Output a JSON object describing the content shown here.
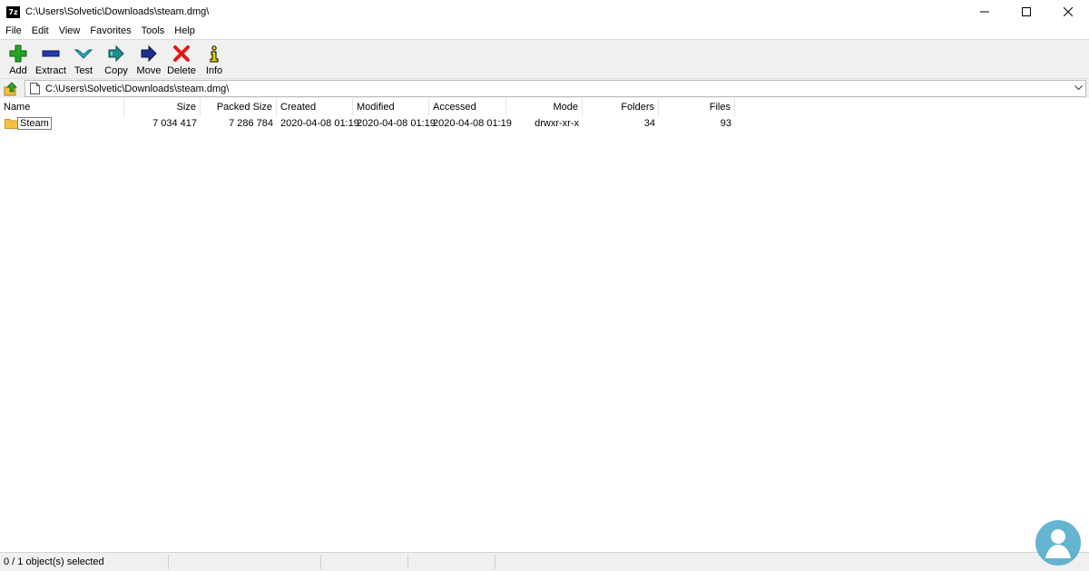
{
  "window": {
    "app_icon_text": "7z",
    "title": "C:\\Users\\Solvetic\\Downloads\\steam.dmg\\"
  },
  "menu": [
    "File",
    "Edit",
    "View",
    "Favorites",
    "Tools",
    "Help"
  ],
  "toolbar": [
    {
      "label": "Add",
      "icon": "add-icon",
      "color": "#22a822"
    },
    {
      "label": "Extract",
      "icon": "extract-icon",
      "color": "#1f3bb3"
    },
    {
      "label": "Test",
      "icon": "test-icon",
      "color": "#2bb5c8"
    },
    {
      "label": "Copy",
      "icon": "copy-icon",
      "color": "#1f8f8f"
    },
    {
      "label": "Move",
      "icon": "move-icon",
      "color": "#1c2f8c"
    },
    {
      "label": "Delete",
      "icon": "delete-icon",
      "color": "#e01919"
    },
    {
      "label": "Info",
      "icon": "info-icon",
      "color": "#e6d200"
    }
  ],
  "address": {
    "path": "C:\\Users\\Solvetic\\Downloads\\steam.dmg\\"
  },
  "columns": [
    "Name",
    "Size",
    "Packed Size",
    "Created",
    "Modified",
    "Accessed",
    "Mode",
    "Folders",
    "Files"
  ],
  "rows": [
    {
      "name": "Steam",
      "size": "7 034 417",
      "packed_size": "7 286 784",
      "created": "2020-04-08 01:19",
      "modified": "2020-04-08 01:19",
      "accessed": "2020-04-08 01:19",
      "mode": "drwxr-xr-x",
      "folders": "34",
      "files": "93"
    }
  ],
  "status": {
    "selection": "0 / 1 object(s) selected"
  },
  "colors": {
    "toolbar_bg": "#f0f0f0",
    "folder": "#f5c242",
    "watermark": "#4aa8c8"
  }
}
